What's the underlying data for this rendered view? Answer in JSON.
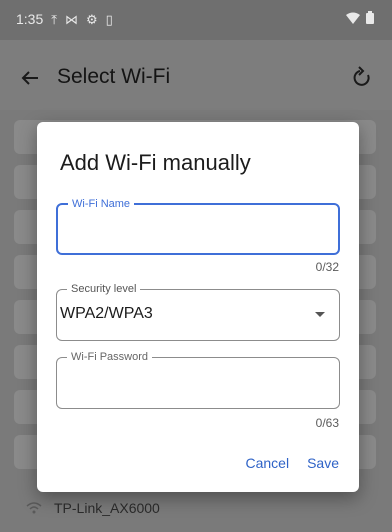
{
  "status_bar": {
    "time": "1:35",
    "icons": [
      "upload-icon",
      "signal-cross-icon",
      "settings-icon",
      "battery-small-icon",
      "wifi-icon",
      "battery-icon"
    ]
  },
  "app_bar": {
    "title": "Select Wi-Fi",
    "back_icon": "arrow-left-icon",
    "refresh_icon": "refresh-icon"
  },
  "background_list": {
    "bottom_network": "TP-Link_AX6000"
  },
  "dialog": {
    "title": "Add Wi-Fi manually",
    "wifi_name": {
      "label": "Wi-Fi Name",
      "value": "",
      "counter": "0/32"
    },
    "security": {
      "label": "Security level",
      "value": "WPA2/WPA3"
    },
    "password": {
      "label": "Wi-Fi Password",
      "value": "",
      "counter": "0/63"
    },
    "actions": {
      "cancel": "Cancel",
      "save": "Save"
    }
  },
  "colors": {
    "accent": "#3f6fd8",
    "scrim": "#7d7d7d",
    "dialog_bg": "#ffffff"
  }
}
